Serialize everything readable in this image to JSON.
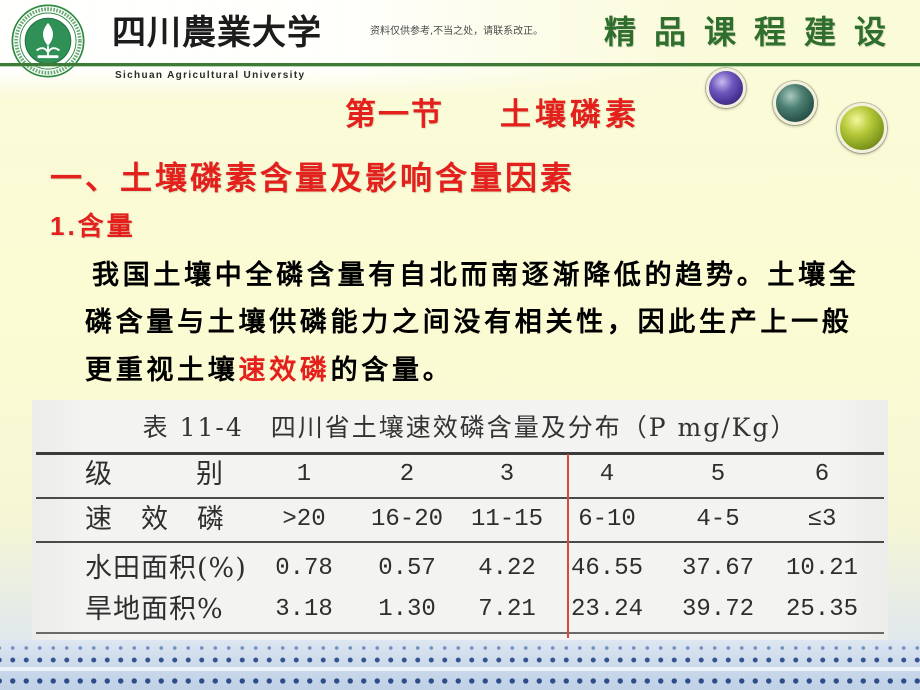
{
  "header": {
    "university_name_cn": "四川農業大学",
    "university_name_en": "Sichuan Agricultural University",
    "notice": "资料仅供参考,不当之处，请联系改正。",
    "course_banner": "精品课程建设"
  },
  "slide": {
    "section_label": "第一节",
    "section_title": "土壤磷素",
    "heading": "一、土壤磷素含量及影响含量因素",
    "subheading": "1.含量",
    "paragraph": {
      "line1": "我国土壤中全磷含量有自北而南逐渐降低的趋势。土壤全",
      "line2": "磷含量与土壤供磷能力之间没有相关性，因此生产上一般",
      "line3_before": "更重视土壤",
      "line3_highlight": "速效磷",
      "line3_after": "的含量。"
    }
  },
  "table": {
    "caption": "表 11-4　四川省土壤速效磷含量及分布（P mg/Kg）",
    "header": {
      "label": "级别",
      "cells": [
        "1",
        "2",
        "3",
        "4",
        "5",
        "6"
      ]
    },
    "rows": [
      {
        "label": "速效磷",
        "cells": [
          ">20",
          "16-20",
          "11-15",
          "6-10",
          "4-5",
          "≤3"
        ]
      },
      {
        "label": "水田面积(%)",
        "cells": [
          "0.78",
          "0.57",
          "4.22",
          "46.55",
          "37.67",
          "10.21"
        ]
      },
      {
        "label": "旱地面积%",
        "cells": [
          "3.18",
          "1.30",
          "7.21",
          "23.24",
          "39.72",
          "25.35"
        ]
      }
    ]
  },
  "icons": {
    "logo": "university-seal-icon",
    "decorations": [
      "purple-sphere",
      "teal-sphere",
      "green-sphere"
    ]
  },
  "colors": {
    "accent_red": "#e3201b",
    "banner_green": "#2f6e2c",
    "header_rule_green": "#3d7a36",
    "body_text": "#000000",
    "table_text": "#2b2b2b",
    "table_divider_red": "#d9473f"
  }
}
